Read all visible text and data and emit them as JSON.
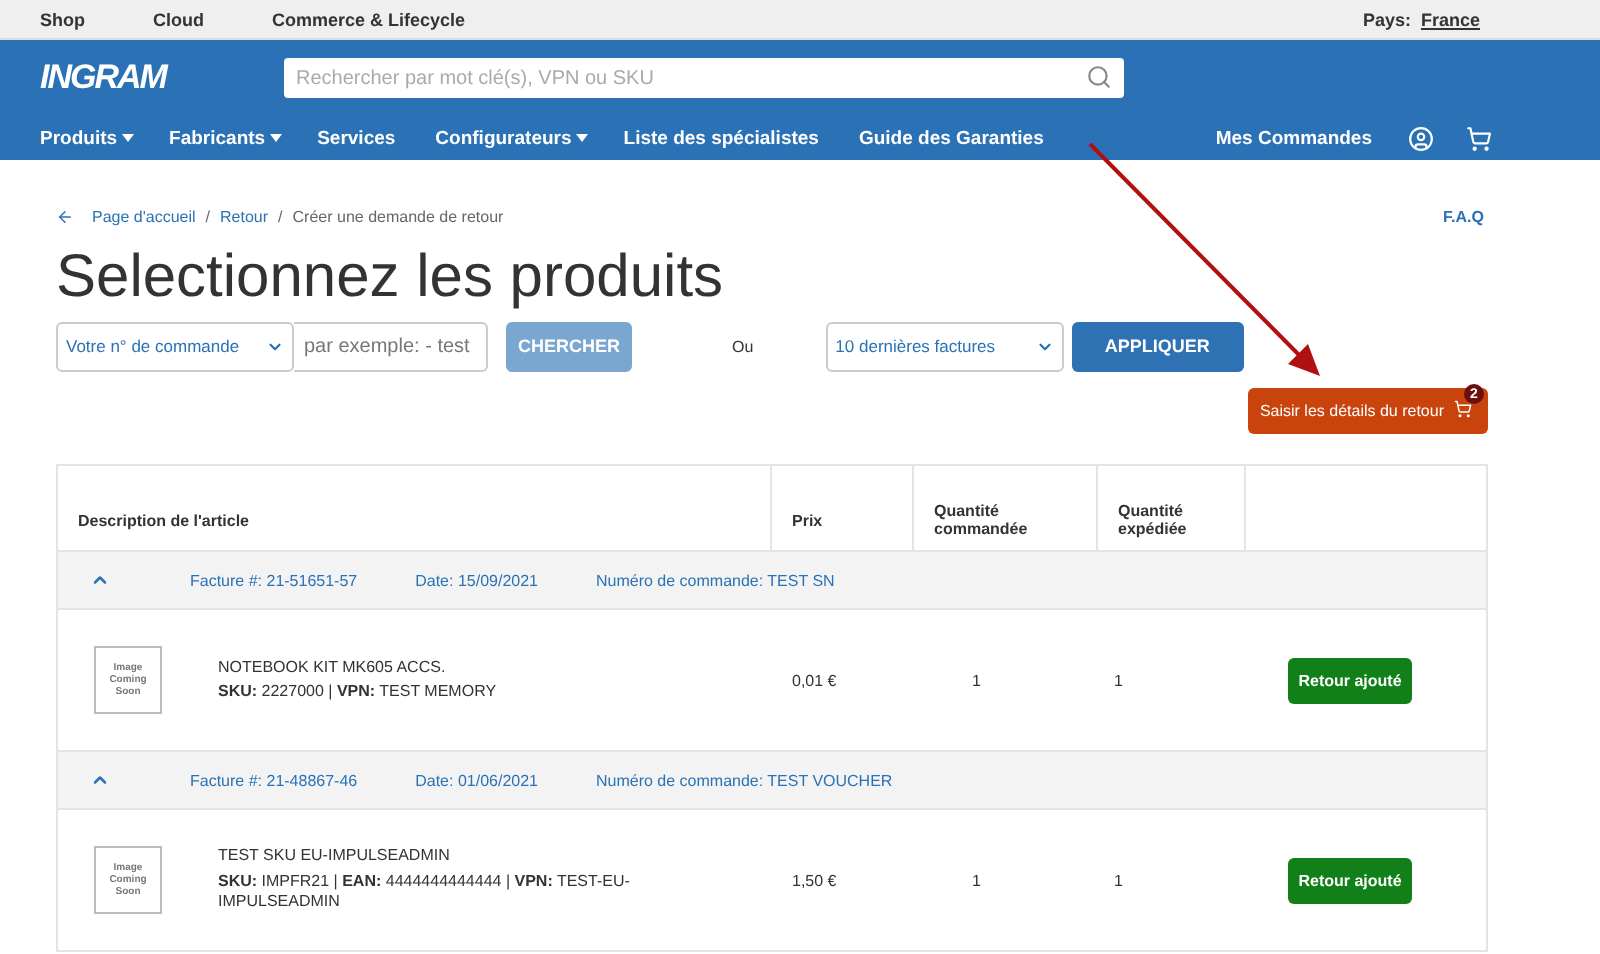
{
  "top_links": [
    "Shop",
    "Cloud",
    "Commerce & Lifecycle"
  ],
  "country": {
    "label": "Pays:",
    "value": "France"
  },
  "logo": "INGRAM",
  "search": {
    "placeholder": "Rechercher par mot clé(s), VPN ou SKU"
  },
  "nav": [
    {
      "label": "Produits",
      "dropdown": true
    },
    {
      "label": "Fabricants",
      "dropdown": true
    },
    {
      "label": "Services",
      "dropdown": false
    },
    {
      "label": "Configurateurs",
      "dropdown": true
    },
    {
      "label": "Liste des spécialistes",
      "dropdown": false
    },
    {
      "label": "Guide des Garanties",
      "dropdown": false
    }
  ],
  "orders_link": "Mes Commandes",
  "breadcrumb": [
    "Page d'accueil",
    "Retour",
    "Créer une demande de retour"
  ],
  "breadcrumb_separator": "/",
  "faq": "F.A.Q",
  "title": "Selectionnez les produits",
  "order_select": "Votre n° de commande",
  "order_input": {
    "placeholder": "par exemple: - test"
  },
  "search_button": "CHERCHER",
  "or": "Ou",
  "invoice_select": "10 dernières factures",
  "apply_button": "APPLIQUER",
  "return_button": {
    "label": "Saisir les détails du retour",
    "count": "2"
  },
  "table": {
    "columns": [
      "Description de l'article",
      "Prix",
      "Quantité commandée",
      "Quantité expédiée"
    ],
    "groups": [
      {
        "expanded": true,
        "invoice": "Facture #: 21-51651-57",
        "date": "Date: 15/09/2021",
        "order": "Numéro de commande: TEST SN",
        "items": [
          {
            "image_text": "Image Coming Soon",
            "name": "NOTEBOOK KIT MK605 ACCS.",
            "details": "**SKU:** 2227000 | **VPN:** TEST MEMORY",
            "price": "0,01 €",
            "ordered": "1",
            "shipped": "1",
            "action": "Retour ajouté"
          }
        ]
      },
      {
        "expanded": true,
        "invoice": "Facture #: 21-48867-46",
        "date": "Date: 01/06/2021",
        "order": "Numéro de commande: TEST VOUCHER",
        "items": [
          {
            "image_text": "Image Coming Soon",
            "name": "TEST SKU EU-IMPULSEADMIN",
            "details": "**SKU:** IMPFR21 | **EAN:** 4444444444444 | **VPN:** TEST-EU-IMPULSEADMIN",
            "price": "1,50 €",
            "ordered": "1",
            "shipped": "1",
            "action": "Retour ajouté"
          }
        ]
      }
    ]
  }
}
